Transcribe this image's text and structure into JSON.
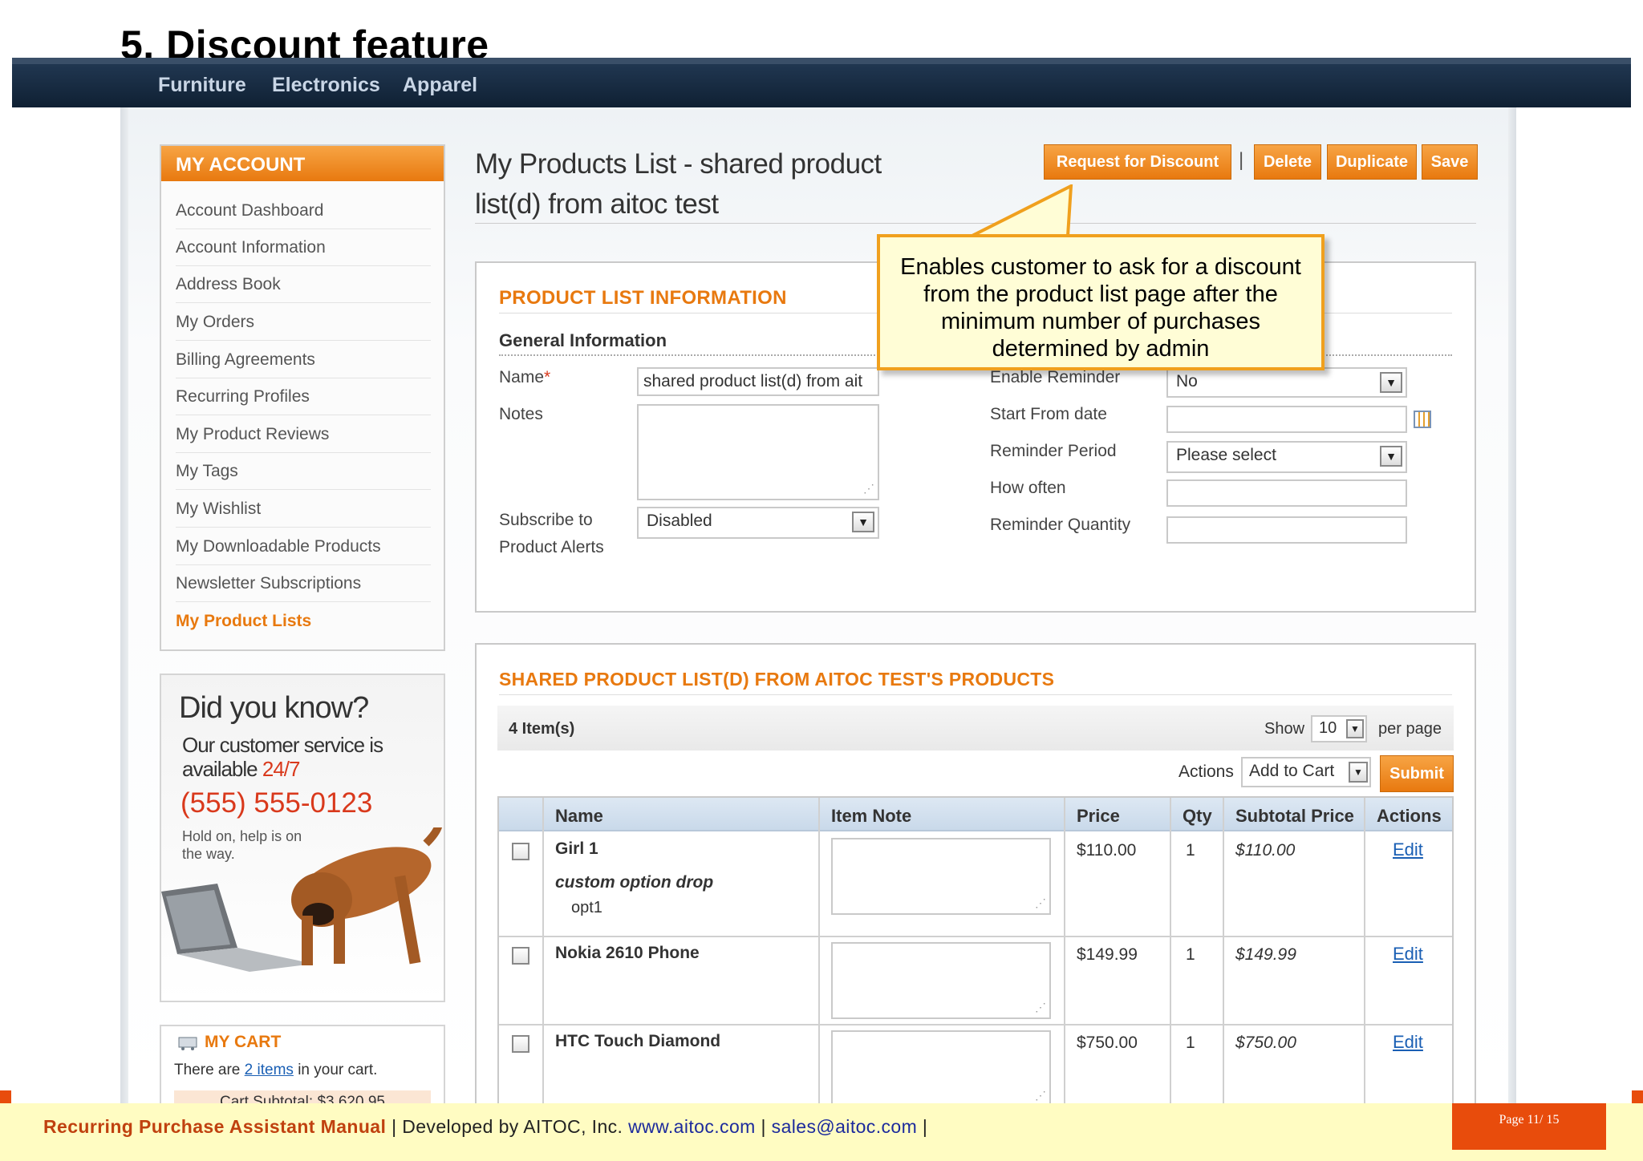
{
  "doc_title": "5. Discount feature",
  "nav": [
    "Furniture",
    "Electronics",
    "Apparel"
  ],
  "sidebar": {
    "header": "MY ACCOUNT",
    "items": [
      "Account Dashboard",
      "Account Information",
      "Address Book",
      "My Orders",
      "Billing Agreements",
      "Recurring Profiles",
      "My Product Reviews",
      "My Tags",
      "My Wishlist",
      "My Downloadable Products",
      "Newsletter Subscriptions",
      "My Product Lists"
    ],
    "active_item": "My Product Lists"
  },
  "promo": {
    "title": "Did you know?",
    "line1": "Our customer service is available",
    "line1_highlight": "24/7",
    "phone": "(555) 555-0123",
    "note": "Hold on, help is on the way."
  },
  "cart": {
    "title": "MY CART",
    "text_before": "There are",
    "items_link": "2 items",
    "text_after": "in your cart.",
    "subtotal": "Cart Subtotal: $3,620.95"
  },
  "page_heading": "My Products List - shared product list(d) from aitoc test",
  "buttons": {
    "request_discount": "Request for Discount",
    "separator": "|",
    "delete": "Delete",
    "duplicate": "Duplicate",
    "save": "Save"
  },
  "callout": "Enables customer to ask for a discount from the product list page after the minimum number of purchases determined by admin",
  "info": {
    "section_title": "PRODUCT LIST INFORMATION",
    "subsection": "General Information",
    "name_label": "Name",
    "name_required": "*",
    "name_value": "shared product list(d) from ait",
    "notes_label": "Notes",
    "subscribe_label_1": "Subscribe to",
    "subscribe_label_2": "Product Alerts",
    "subscribe_value": "Disabled",
    "enable_reminder_label": "Enable Reminder",
    "enable_reminder_value": "No",
    "start_date_label": "Start From date",
    "reminder_period_label": "Reminder Period",
    "reminder_period_value": "Please select",
    "how_often_label": "How often",
    "reminder_qty_label": "Reminder Quantity"
  },
  "products": {
    "section_title": "SHARED PRODUCT LIST(D) FROM AITOC TEST'S PRODUCTS",
    "count": "4 Item(s)",
    "show_label": "Show",
    "show_value": "10",
    "per_page_label": "per page",
    "actions_label": "Actions",
    "actions_value": "Add to Cart",
    "submit": "Submit",
    "columns": [
      "Name",
      "Item Note",
      "Price",
      "Qty",
      "Subtotal Price",
      "Actions"
    ],
    "rows": [
      {
        "name": "Girl 1",
        "option_label": "custom option drop",
        "option_value": "opt1",
        "price": "$110.00",
        "qty": "1",
        "subtotal": "$110.00",
        "action": "Edit"
      },
      {
        "name": "Nokia 2610 Phone",
        "option_label": "",
        "option_value": "",
        "price": "$149.99",
        "qty": "1",
        "subtotal": "$149.99",
        "action": "Edit"
      },
      {
        "name": "HTC Touch Diamond",
        "option_label": "",
        "option_value": "",
        "price": "$750.00",
        "qty": "1",
        "subtotal": "$750.00",
        "action": "Edit"
      }
    ]
  },
  "footer": {
    "brand": "Recurring Purchase Assistant Manual",
    "sep1": " | Developed by AITOC, Inc. ",
    "site": "www.aitoc.com",
    "sep2": " | ",
    "email": "sales@aitoc.com",
    "sep3": " |",
    "page": "Page 11/ 15"
  },
  "colors": {
    "accent_orange": "#e8790f",
    "nav_dark": "#0f2033",
    "link_blue": "#1a5fb4",
    "callout_border": "#f0a01e",
    "footer_bg": "#fffcc2",
    "page_badge": "#e84c0c"
  }
}
